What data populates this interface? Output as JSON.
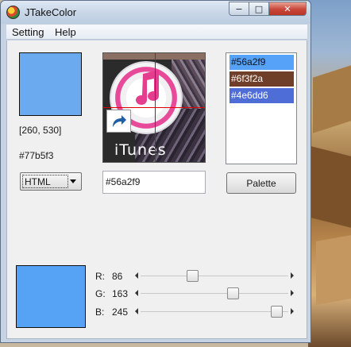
{
  "window": {
    "title": "JTakeColor",
    "minimize_glyph": "−",
    "maximize_glyph": "□",
    "close_glyph": "✕"
  },
  "menu": {
    "items": [
      "Setting",
      "Help"
    ]
  },
  "picker": {
    "top_swatch_color": "#6caaf0",
    "coordinates": "[260, 530]",
    "hex_value": "#77b5f3",
    "format_select": "HTML",
    "zoom_label": "iTunes",
    "hex_input": "#56a2f9"
  },
  "history": {
    "items": [
      {
        "hex": "#56a2f9",
        "color": "#56a2f9",
        "text_color": "#111111"
      },
      {
        "hex": "#6f3f2a",
        "color": "#6f3f2a",
        "text_color": "#ffffff"
      },
      {
        "hex": "#4e6dd6",
        "color": "#4e6dd6",
        "text_color": "#ffffff"
      }
    ]
  },
  "palette_button": "Palette",
  "rgb": {
    "swatch_color": "#56a2f5",
    "r": {
      "label": "R:",
      "value": "86",
      "level": 86
    },
    "g": {
      "label": "G:",
      "value": "163",
      "level": 163
    },
    "b": {
      "label": "B:",
      "value": "245",
      "level": 245
    }
  }
}
